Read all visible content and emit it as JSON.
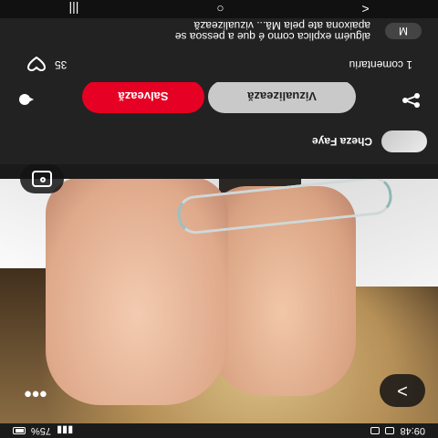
{
  "status_bar": {
    "time": "09:48",
    "battery": "75%"
  },
  "photo": {
    "more_label": "•••",
    "share_label": ">"
  },
  "creator": {
    "name": "Cheza Faye"
  },
  "actions": {
    "visit_label": "Vizualizează",
    "save_label": "Salvează",
    "accent": "#e60023"
  },
  "stats": {
    "comment_count": "1 comentariu",
    "reactions": "35"
  },
  "comment": {
    "avatar_letter": "M",
    "text": "alguém explica como é que a pessoa se\napaixona ate pela Mă... vizualizează"
  },
  "navbar": {
    "back": "<",
    "home": "○",
    "recents": "|||"
  }
}
